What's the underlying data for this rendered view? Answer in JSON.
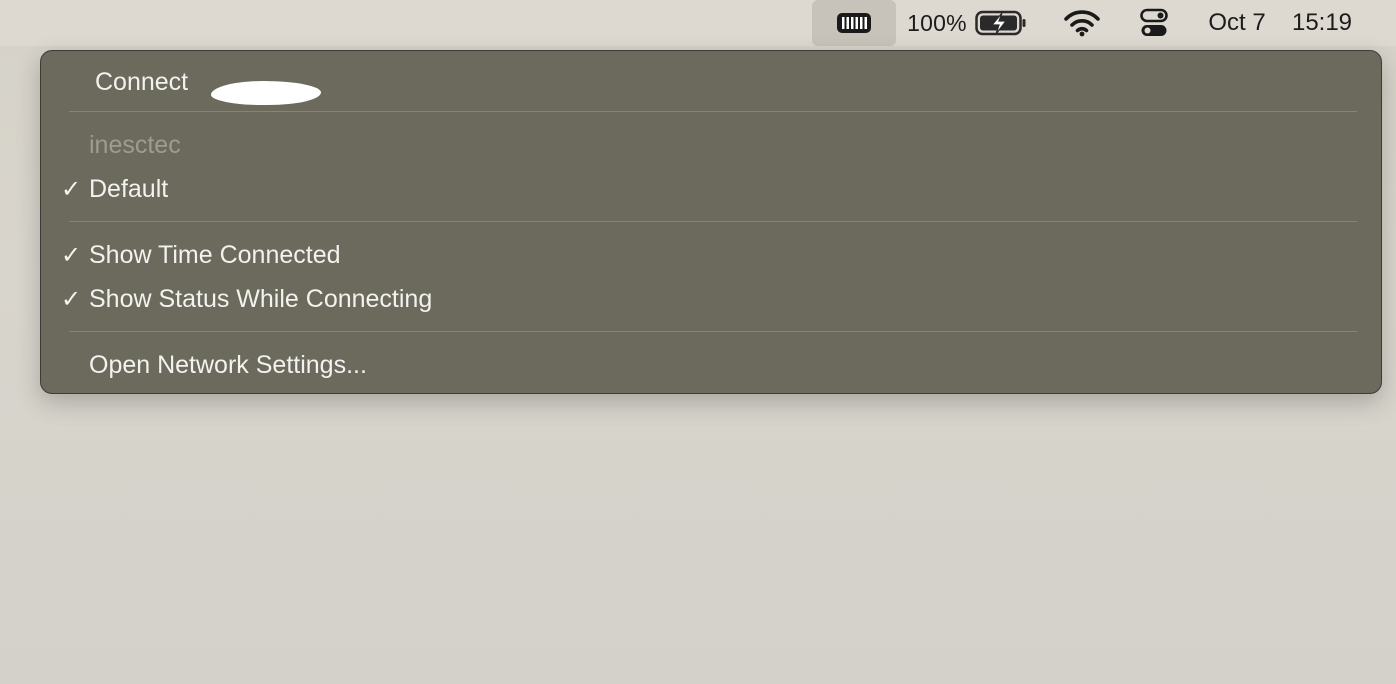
{
  "menubar": {
    "vpn_icon": "vpn-status-icon",
    "battery_percent": "100%",
    "battery_icon": "battery-charging-icon",
    "wifi_icon": "wifi-icon",
    "control_center_icon": "control-center-icon",
    "date": "Oct 7",
    "time": "15:19"
  },
  "menu": {
    "connect_label": "Connect",
    "section_header": "inesctec",
    "items": [
      {
        "label": "Default",
        "checked": true
      },
      {
        "label": "Show Time Connected",
        "checked": true
      },
      {
        "label": "Show Status While Connecting",
        "checked": true
      },
      {
        "label": "Open Network Settings...",
        "checked": false
      }
    ],
    "check_glyph": "✓"
  },
  "colors": {
    "menu_background": "#6b6a5d",
    "menu_text": "#f2f2ee",
    "disabled_text": "#9d9c92",
    "menubar_background": "#ded9d0"
  }
}
